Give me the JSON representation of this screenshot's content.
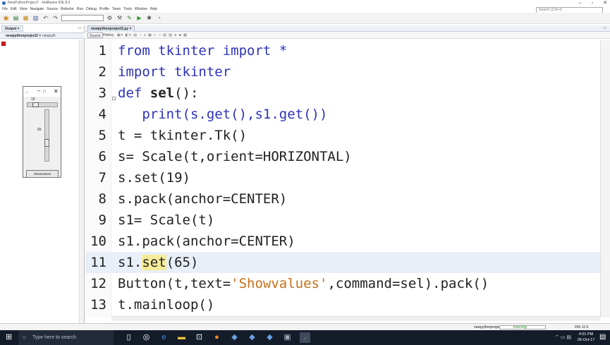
{
  "window": {
    "title": "NewPythonProject7 - NetBeans IDE 8.0",
    "controls": [
      "–",
      "▫",
      "✕"
    ]
  },
  "menu": [
    "File",
    "Edit",
    "View",
    "Navigate",
    "Source",
    "Refactor",
    "Run",
    "Debug",
    "Profile",
    "Team",
    "Tools",
    "Window",
    "Help"
  ],
  "search": {
    "placeholder": "Search (Ctrl+I)"
  },
  "output_panel": {
    "tab_label": "Output ×",
    "subtab_active": "newpythonproject2 ×",
    "subtab_2": "newpyth"
  },
  "tk_window": {
    "scale_horizontal_value": "19",
    "scale_horizontal_fraction": 0.19,
    "scale_vertical_value": "65",
    "scale_vertical_fraction": 0.65,
    "button_label": "Showvalues"
  },
  "editor": {
    "file_tab": "newpythonproject2.py ×",
    "toolbar_source": "Source",
    "toolbar_history": "History",
    "lines": [
      {
        "n": "1",
        "html_parts": [
          {
            "t": "from tkinter import *",
            "c": "kw"
          }
        ]
      },
      {
        "n": "2",
        "html_parts": [
          {
            "t": "import tkinter",
            "c": "kw"
          }
        ]
      },
      {
        "n": "3",
        "html_parts": [
          {
            "t": "def ",
            "c": "kw"
          },
          {
            "t": "sel",
            "c": "fn"
          },
          {
            "t": "():",
            "c": ""
          }
        ]
      },
      {
        "n": "4",
        "html_parts": [
          {
            "t": "   print(s.get(),s1.get())",
            "c": "kw"
          }
        ]
      },
      {
        "n": "5",
        "html_parts": [
          {
            "t": "t = tkinter.Tk()",
            "c": ""
          }
        ]
      },
      {
        "n": "6",
        "html_parts": [
          {
            "t": "s= Scale(t,orient=HORIZONTAL)",
            "c": ""
          }
        ]
      },
      {
        "n": "7",
        "html_parts": [
          {
            "t": "s.set(19)",
            "c": ""
          }
        ]
      },
      {
        "n": "8",
        "html_parts": [
          {
            "t": "s.pack(anchor=CENTER)",
            "c": ""
          }
        ]
      },
      {
        "n": "9",
        "html_parts": [
          {
            "t": "s1= Scale(t)",
            "c": ""
          }
        ]
      },
      {
        "n": "10",
        "html_parts": [
          {
            "t": "s1.pack(anchor=CENTER)",
            "c": ""
          }
        ]
      },
      {
        "n": "11",
        "html_parts": [
          {
            "t": "s1.",
            "c": ""
          },
          {
            "t": "set",
            "c": "hl"
          },
          {
            "t": "(65)",
            "c": ""
          }
        ]
      },
      {
        "n": "12",
        "html_parts": [
          {
            "t": "Button(t,text=",
            "c": ""
          },
          {
            "t": "'Showvalues'",
            "c": "str"
          },
          {
            "t": ",command=sel).pack()",
            "c": ""
          }
        ]
      },
      {
        "n": "13",
        "html_parts": [
          {
            "t": "t.mainloop()",
            "c": ""
          }
        ]
      }
    ],
    "current_line": "11"
  },
  "status": {
    "project": "newpythonproject2",
    "running": "Running",
    "insert_mode": "INS",
    "position": "11:6"
  },
  "taskbar": {
    "search_placeholder": "Type here to search",
    "time": "4:01 PM",
    "date": "06-Oct-17"
  },
  "colors": {
    "keyword": "#2d32b8",
    "string": "#c5711a",
    "current_line": "#e9eff8",
    "highlight": "#f7ec9a",
    "taskbar": "#141c2a"
  }
}
